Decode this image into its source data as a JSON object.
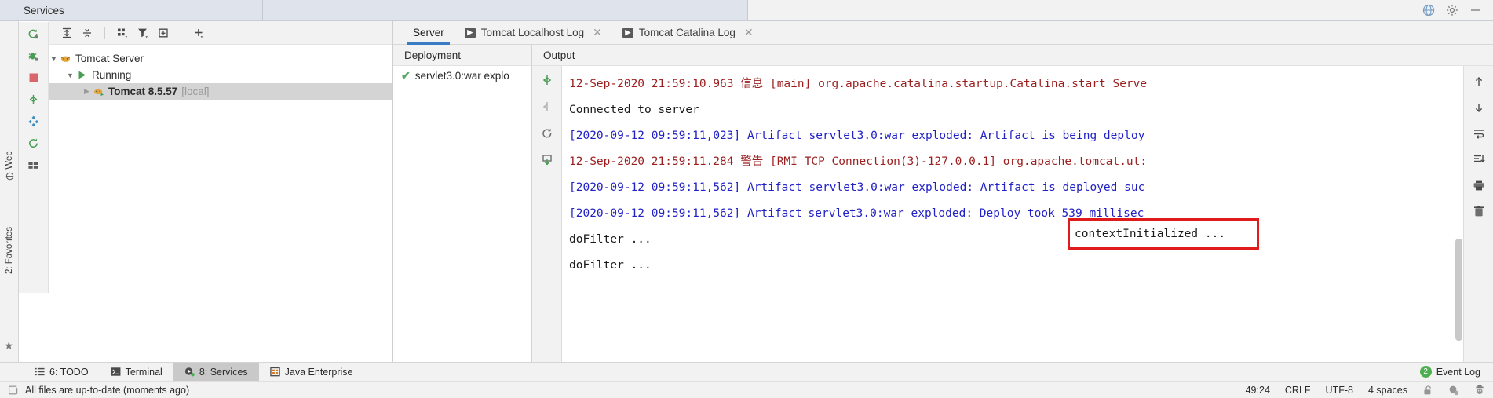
{
  "titlebar": {
    "title": "Services",
    "icons": [
      "globe-icon",
      "gear-icon",
      "minimize-icon"
    ]
  },
  "left_rail": {
    "web_label": "Web",
    "favorites_label": "2: Favorites",
    "star_icon": "star-icon"
  },
  "services_toolbar": {
    "buttons": [
      "expand-all-icon",
      "collapse-all-icon",
      "group-by-icon",
      "filter-icon",
      "add-tab-icon",
      "add-icon"
    ]
  },
  "services_side_tools": {
    "buttons": [
      "rerun-icon",
      "debug-icon",
      "stop-icon",
      "deploy-icon",
      "artifacts-icon",
      "restart-icon",
      "layout-icon"
    ]
  },
  "tree": {
    "nodes": [
      {
        "label": "Tomcat Server",
        "icon": "tomcat-icon",
        "expanded": true,
        "indent": 0,
        "selected": false,
        "bold": false,
        "suffix": ""
      },
      {
        "label": "Running",
        "icon": "run-green-icon",
        "expanded": true,
        "indent": 1,
        "selected": false,
        "bold": false,
        "suffix": ""
      },
      {
        "label": "Tomcat 8.5.57",
        "icon": "tomcat-run-icon",
        "expanded": false,
        "indent": 2,
        "selected": true,
        "bold": true,
        "suffix": "[local]"
      }
    ]
  },
  "tabs": [
    {
      "label": "Server",
      "active": true,
      "icon": null,
      "closable": false
    },
    {
      "label": "Tomcat Localhost Log",
      "active": false,
      "icon": "run-console-icon",
      "closable": true
    },
    {
      "label": "Tomcat Catalina Log",
      "active": false,
      "icon": "run-console-icon",
      "closable": true
    }
  ],
  "deployment": {
    "header": "Deployment",
    "items": [
      {
        "label": "servlet3.0:war explo",
        "status_icon": "check-green-icon"
      }
    ]
  },
  "output": {
    "header": "Output",
    "gutter_icons": [
      "deploy-down-icon",
      "undeploy-icon",
      "restart-circle-icon",
      "update-icon"
    ],
    "lines": [
      {
        "text": "12-Sep-2020 21:59:10.963 信息 [main] org.apache.catalina.startup.Catalina.start Serve",
        "color": "red"
      },
      {
        "text": "Connected to server",
        "color": "black"
      },
      {
        "text": "[2020-09-12 09:59:11,023] Artifact servlet3.0:war exploded: Artifact is being deploy",
        "color": "blue"
      },
      {
        "text": "12-Sep-2020 21:59:11.284 警告 [RMI TCP Connection(3)-127.0.0.1] org.apache.tomcat.ut:",
        "color": "red"
      },
      {
        "text": "[2020-09-12 09:59:11,562] Artifact servlet3.0:war exploded: Artifact is deployed suc",
        "color": "blue"
      },
      {
        "text": "[2020-09-12 09:59:11,562] Artifact servlet3.0:war exploded: Deploy took 539 millisec",
        "color": "blue",
        "caret_after": 35
      },
      {
        "text": "doFilter ...",
        "color": "black"
      },
      {
        "text": "doFilter ...",
        "color": "black"
      }
    ],
    "highlight": {
      "text": "contextInitialized ...",
      "border_color": "#e01b1b"
    },
    "right_toolbar_icons": [
      "arrow-up-icon",
      "arrow-down-icon",
      "soft-wrap-icon",
      "scroll-to-end-icon",
      "print-icon",
      "trash-icon"
    ]
  },
  "bottom_bar": {
    "items": [
      {
        "label": "6: TODO",
        "mnemonic": "6",
        "icon": "todo-icon",
        "active": false
      },
      {
        "label": "Terminal",
        "mnemonic": "",
        "icon": "terminal-icon",
        "active": false
      },
      {
        "label": "8: Services",
        "mnemonic": "8",
        "icon": "services-icon",
        "active": true
      },
      {
        "label": "Java Enterprise",
        "mnemonic": "",
        "icon": "java-enterprise-icon",
        "active": false
      }
    ],
    "event_log": {
      "label": "Event Log",
      "count": "2",
      "badge_color": "#4caf50"
    }
  },
  "status_bar": {
    "message": "All files are up-to-date (moments ago)",
    "message_icon": "file-icon",
    "position": "49:24",
    "line_separator": "CRLF",
    "encoding": "UTF-8",
    "indent": "4 spaces",
    "icons": [
      "lock-open-icon",
      "inspection-icon",
      "hector-icon"
    ]
  }
}
